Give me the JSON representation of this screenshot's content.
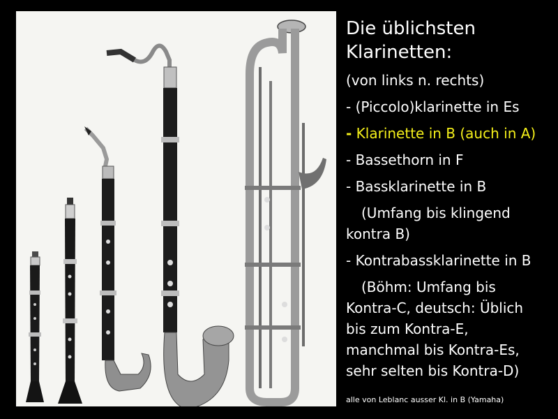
{
  "slide": {
    "title_line1": "Die üblichsten",
    "title_line2": "Klarinetten:",
    "intro": "(von links n. rechts)",
    "items": [
      "- (Piccolo)klarinette in Es",
      "Klarinette in B (auch in A)",
      "- Bassethorn in F",
      "- Bassklarinette in B"
    ],
    "highlight_dash": "-",
    "bass_note_line1": "(Umfang bis klingend",
    "bass_note_line2": "kontra B)",
    "contra_item": "- Kontrabassklarinette in B",
    "contra_note_line1": "(Böhm: Umfang bis",
    "contra_note_line2": "Kontra-C, deutsch: Üblich",
    "contra_note_line3": "bis zum Kontra-E,",
    "contra_note_line4": "manchmal bis Kontra-Es,",
    "contra_note_line5": "sehr selten bis Kontra-D)",
    "footnote": "alle von Leblanc ausser Kl. in B (Yamaha)"
  },
  "colors": {
    "background": "#000000",
    "text": "#ffffff",
    "highlight": "#f5f01a"
  }
}
